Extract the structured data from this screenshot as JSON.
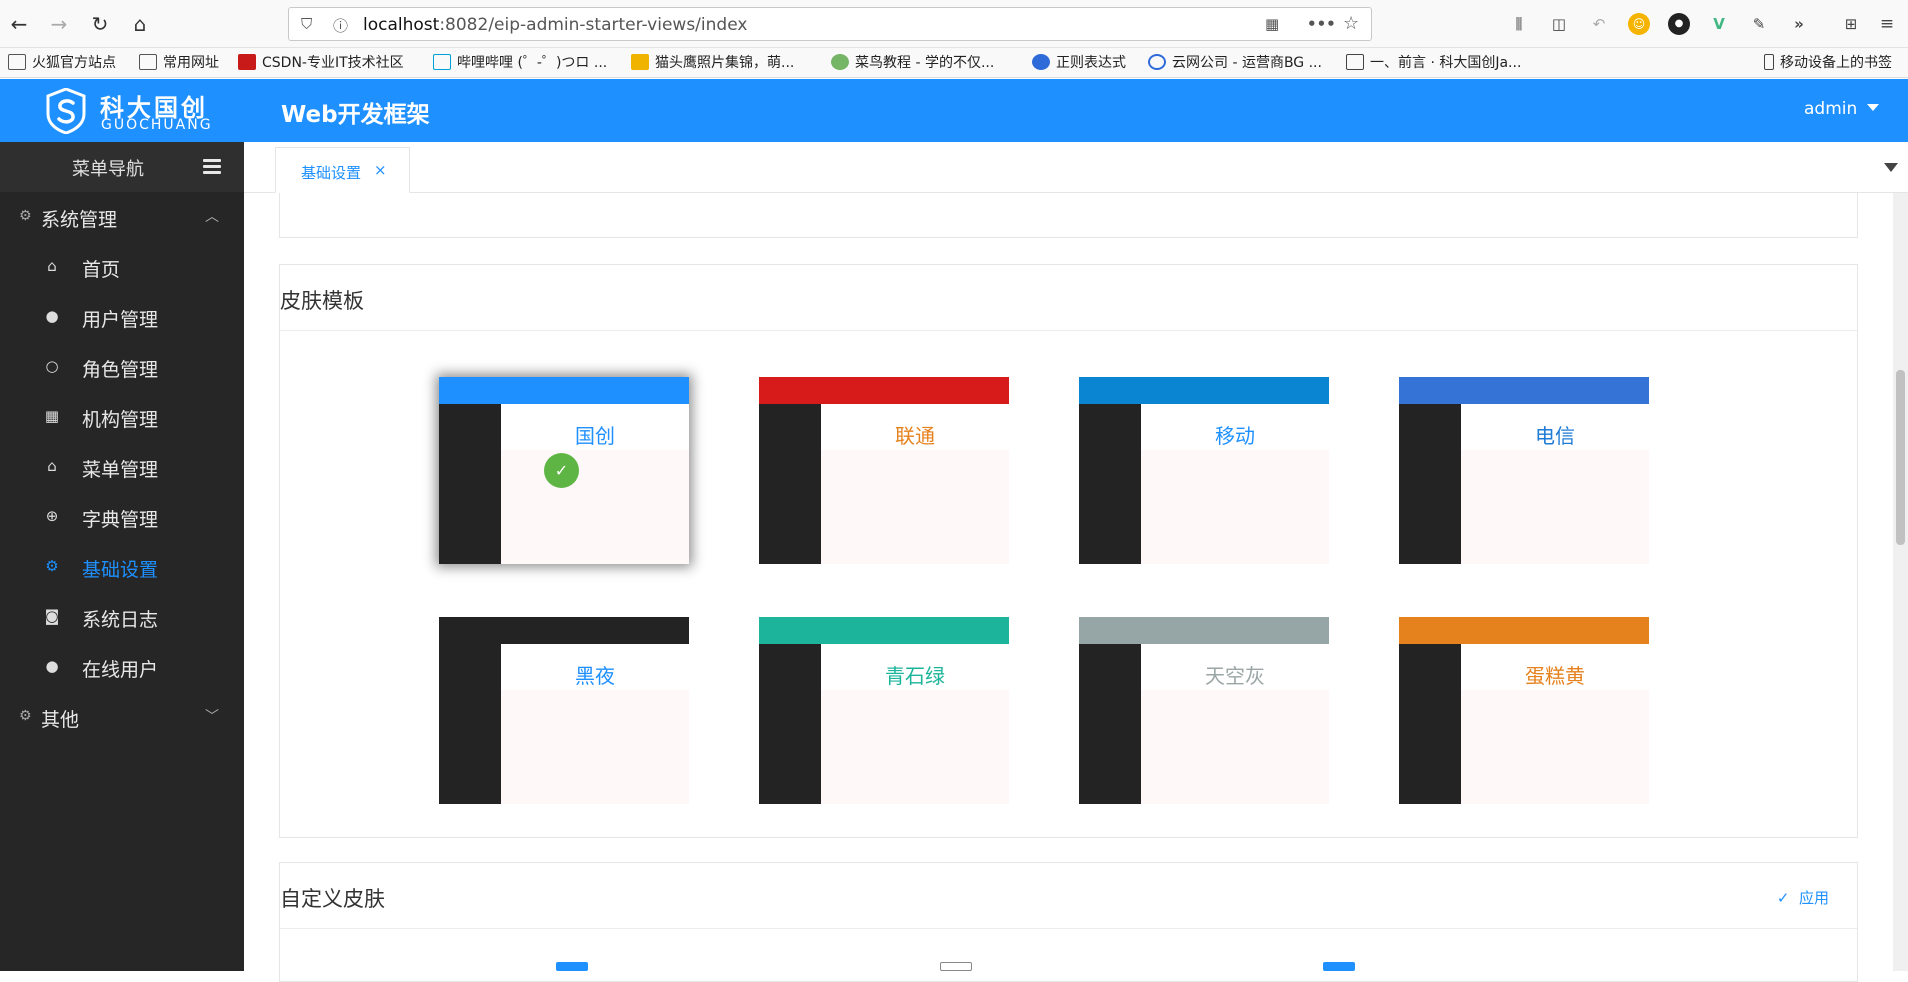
{
  "browser": {
    "url_host": "localhost",
    "url_port": ":8082",
    "url_path": "/eip-admin-starter-views/index",
    "bookmarks": [
      "火狐官方站点",
      "常用网址",
      "CSDN-专业IT技术社区",
      "哔哩哔哩 (゜-゜)つロ ...",
      "猫头鹰照片集锦，萌...",
      "菜鸟教程 - 学的不仅...",
      "正则表达式",
      "云网公司 - 运营商BG ...",
      "一、前言 · 科大国创Ja...",
      "移动设备上的书签"
    ]
  },
  "header": {
    "logo_cn": "科大国创",
    "logo_en": "GUOCHUANG",
    "app_title": "Web开发框架",
    "user": "admin"
  },
  "sidebar": {
    "title": "菜单导航",
    "groups": [
      {
        "label": "系统管理"
      },
      {
        "label": "其他"
      }
    ],
    "items": [
      {
        "label": "首页",
        "icon": "home-icon"
      },
      {
        "label": "用户管理",
        "icon": "user-icon"
      },
      {
        "label": "角色管理",
        "icon": "role-icon"
      },
      {
        "label": "机构管理",
        "icon": "org-icon"
      },
      {
        "label": "菜单管理",
        "icon": "menu-icon"
      },
      {
        "label": "字典管理",
        "icon": "dict-icon"
      },
      {
        "label": "基础设置",
        "icon": "gear-icon",
        "active": true
      },
      {
        "label": "系统日志",
        "icon": "camera-icon"
      },
      {
        "label": "在线用户",
        "icon": "user-icon"
      }
    ],
    "active_color": "#1e90ff"
  },
  "tabs": [
    {
      "label": "基础设置",
      "close": "×"
    }
  ],
  "skin_panel": {
    "title": "皮肤模板",
    "skins": [
      {
        "name": "国创",
        "top": "#1e90ff",
        "text": "#1e90ff",
        "selected": true
      },
      {
        "name": "联通",
        "top": "#d71a1a",
        "text": "#e6821e",
        "selected": false
      },
      {
        "name": "移动",
        "top": "#0a85d2",
        "text": "#1e90ff",
        "selected": false
      },
      {
        "name": "电信",
        "top": "#3574d6",
        "text": "#1e7bd6",
        "selected": false
      },
      {
        "name": "黑夜",
        "top": "#232323",
        "text": "#1e90ff",
        "selected": false
      },
      {
        "name": "青石绿",
        "top": "#1cb59b",
        "text": "#1cb59b",
        "selected": false
      },
      {
        "name": "天空灰",
        "top": "#96a5a6",
        "text": "#9aa5a6",
        "selected": false
      },
      {
        "name": "蛋糕黄",
        "top": "#e6821e",
        "text": "#e6821e",
        "selected": false
      }
    ]
  },
  "custom_panel": {
    "title": "自定义皮肤",
    "apply_label": "应用",
    "apply_icon": "✓"
  }
}
